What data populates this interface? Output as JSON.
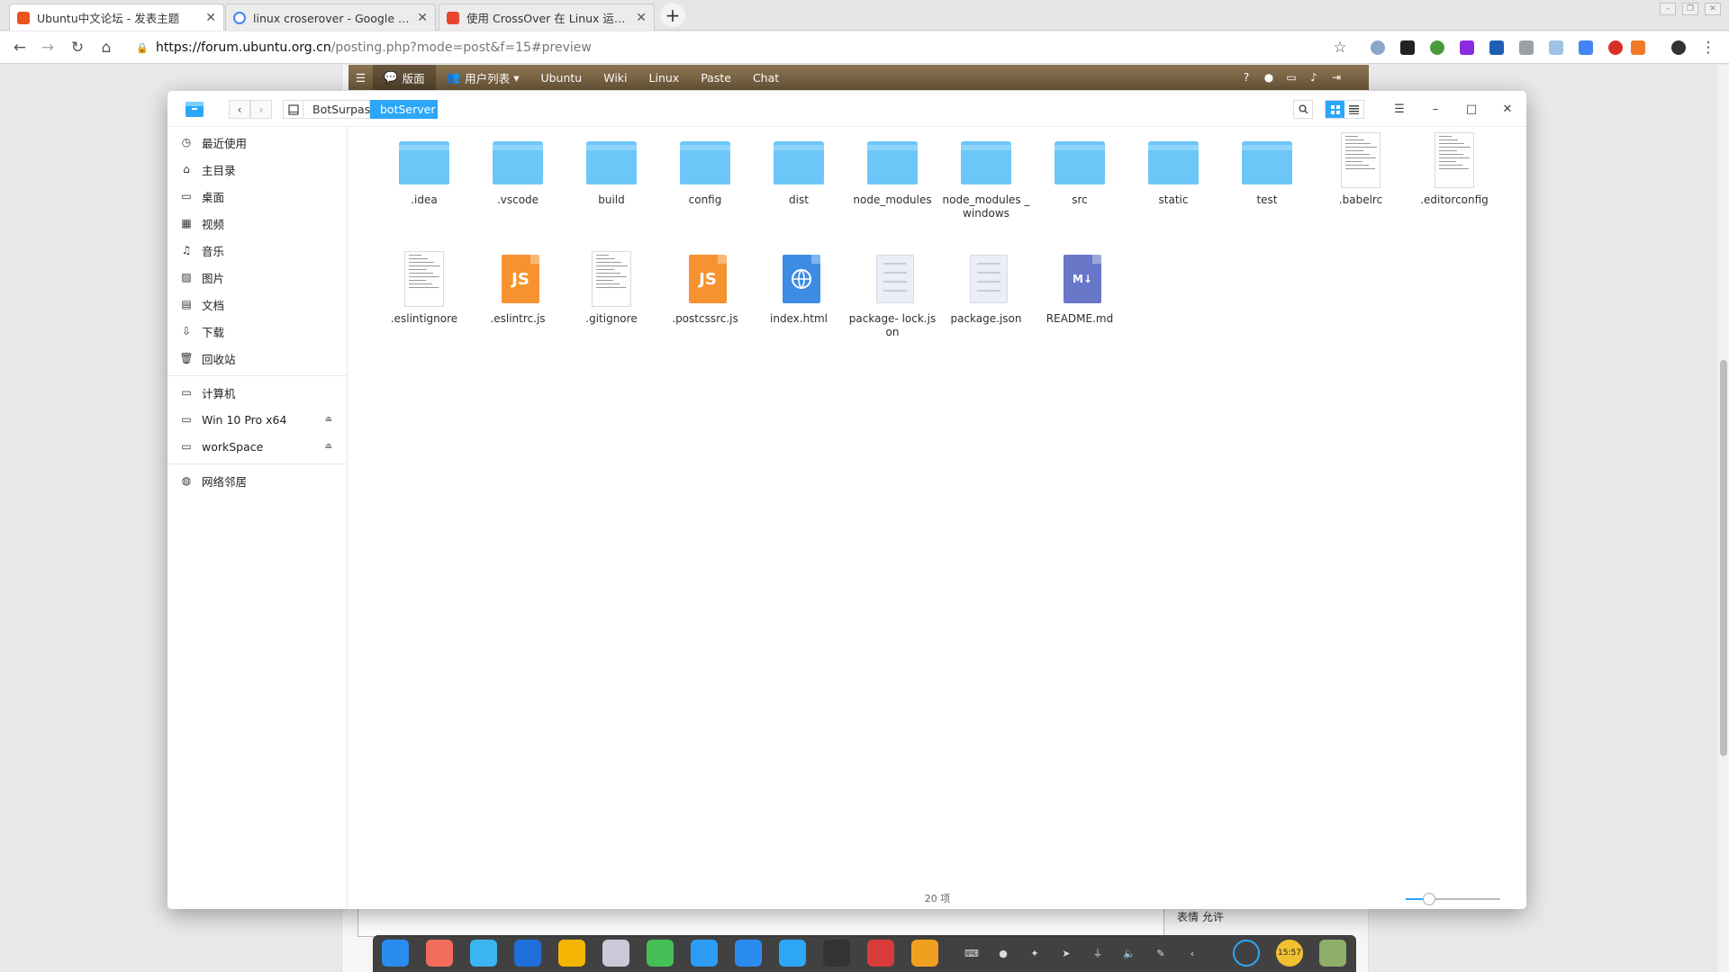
{
  "browser": {
    "tabs": [
      {
        "title": "Ubuntu中文论坛 - 发表主题",
        "active": true,
        "favicon_color": "#e95420"
      },
      {
        "title": "linux croserover - Google 搜索",
        "active": false,
        "favicon_color": "#4285f4"
      },
      {
        "title": "使用 CrossOver 在 Linux 运行 Wi",
        "active": false,
        "favicon_color": "#e8442f"
      }
    ],
    "new_tab_label": "+",
    "url_host": "https://forum.ubuntu.org.cn",
    "url_path": "/posting.php?mode=post&f=15#preview"
  },
  "forum": {
    "nav": [
      {
        "label": "版面",
        "icon": "speech-bubble-icon"
      },
      {
        "label": "用户列表",
        "icon": "users-icon"
      },
      {
        "label": "Ubuntu"
      },
      {
        "label": "Wiki"
      },
      {
        "label": "Linux"
      },
      {
        "label": "Paste"
      },
      {
        "label": "Chat"
      }
    ],
    "side_text": "表情 允许"
  },
  "file_manager": {
    "breadcrumbs": [
      "BotSurpass",
      "botServer"
    ],
    "sidebar": {
      "groups": [
        [
          {
            "label": "最近使用",
            "icon": "clock-icon"
          },
          {
            "label": "主目录",
            "icon": "home-icon"
          },
          {
            "label": "桌面",
            "icon": "desktop-icon"
          },
          {
            "label": "视频",
            "icon": "video-icon"
          },
          {
            "label": "音乐",
            "icon": "music-icon"
          },
          {
            "label": "图片",
            "icon": "picture-icon"
          },
          {
            "label": "文档",
            "icon": "document-icon"
          },
          {
            "label": "下载",
            "icon": "download-icon"
          },
          {
            "label": "回收站",
            "icon": "trash-icon"
          }
        ],
        [
          {
            "label": "计算机",
            "icon": "computer-icon"
          },
          {
            "label": "Win 10 Pro x64",
            "icon": "drive-icon",
            "eject": true
          },
          {
            "label": "workSpace",
            "icon": "drive-icon",
            "eject": true
          }
        ],
        [
          {
            "label": "网络邻居",
            "icon": "network-icon"
          }
        ]
      ]
    },
    "files": [
      {
        "name": ".idea",
        "type": "folder"
      },
      {
        "name": ".vscode",
        "type": "folder"
      },
      {
        "name": "build",
        "type": "folder"
      },
      {
        "name": "config",
        "type": "folder"
      },
      {
        "name": "dist",
        "type": "folder"
      },
      {
        "name": "node_modules",
        "type": "folder"
      },
      {
        "name": "node_modules _windows",
        "type": "folder"
      },
      {
        "name": "src",
        "type": "folder"
      },
      {
        "name": "static",
        "type": "folder"
      },
      {
        "name": "test",
        "type": "folder"
      },
      {
        "name": ".babelrc",
        "type": "text"
      },
      {
        "name": ".editorconfig",
        "type": "text"
      },
      {
        "name": ".eslintignore",
        "type": "text"
      },
      {
        "name": ".eslintrc.js",
        "type": "js"
      },
      {
        "name": ".gitignore",
        "type": "text"
      },
      {
        "name": ".postcssrc.js",
        "type": "js"
      },
      {
        "name": "index.html",
        "type": "html"
      },
      {
        "name": "package- lock.json",
        "type": "json"
      },
      {
        "name": "package.json",
        "type": "json"
      },
      {
        "name": "README.md",
        "type": "md"
      }
    ],
    "status": "20 项",
    "zoom_level": 0.25,
    "accent": "#2ca7f8"
  },
  "dock": {
    "apps": [
      "deepin-launcher-icon",
      "screen-recorder-icon",
      "file-manager-icon",
      "video-player-icon",
      "chrome-icon",
      "settings-icon",
      "wechat-icon",
      "app-store-icon",
      "feishu-icon",
      "control-center-icon",
      "sublime-icon",
      "terminal-icon",
      "archive-icon"
    ],
    "app_colors": [
      "#2b8cf0",
      "#f26b5b",
      "#3bb5f2",
      "#1e6fd9",
      "#f4b400",
      "#c9c9d9",
      "#44c057",
      "#2d9cf5",
      "#2b8cf0",
      "#2ca7f8",
      "#333333",
      "#d93a3a",
      "#f0a020"
    ],
    "tray": [
      "keyboard-icon",
      "wechat-tray-icon",
      "app-store-tray-icon",
      "telegram-icon",
      "usb-icon",
      "volume-icon",
      "pen-icon",
      "collapse-icon"
    ],
    "clock": "15:57"
  }
}
